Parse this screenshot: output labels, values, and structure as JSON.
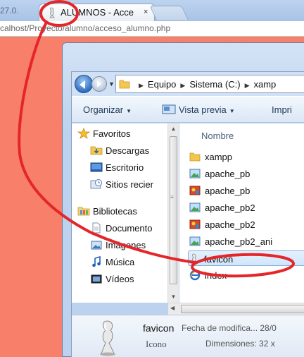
{
  "browser": {
    "left_fragment": "27.0.",
    "tab_title": "ALUMNOS - Acce",
    "tab_close": "×",
    "url": "calhost/Proyecto/alumno/acceso_alumno.php"
  },
  "explorer": {
    "breadcrumbs": [
      "Equipo",
      "Sistema (C:)",
      "xamp"
    ],
    "toolbar": {
      "organize": "Organizar",
      "preview": "Vista previa",
      "print": "Impri"
    },
    "nav": {
      "favorites_label": "Favoritos",
      "favorites": [
        "Descargas",
        "Escritorio",
        "Sitios recier"
      ],
      "libraries_label": "Bibliotecas",
      "libraries": [
        "Documento",
        "Imágenes",
        "Música",
        "Vídeos"
      ]
    },
    "column_header": "Nombre",
    "files": [
      {
        "name": "xampp",
        "icon": "folder-icon"
      },
      {
        "name": "apache_pb",
        "icon": "image-file-icon"
      },
      {
        "name": "apache_pb",
        "icon": "paint-file-icon"
      },
      {
        "name": "apache_pb2",
        "icon": "image-file-icon"
      },
      {
        "name": "apache_pb2",
        "icon": "paint-file-icon"
      },
      {
        "name": "apache_pb2_ani",
        "icon": "image-file-icon"
      },
      {
        "name": "favicon",
        "icon": "favicon-file-icon",
        "selected": true
      },
      {
        "name": "index",
        "icon": "ie-file-icon"
      }
    ],
    "details": {
      "name": "favicon",
      "type": "Icono",
      "modified": "Fecha de modifica... 28/0",
      "dimensions": "Dimensiones: 32 x"
    }
  },
  "colors": {
    "page_background": "#f8806b",
    "annotation": "#e4262b",
    "selection": "#cfe6fb"
  }
}
